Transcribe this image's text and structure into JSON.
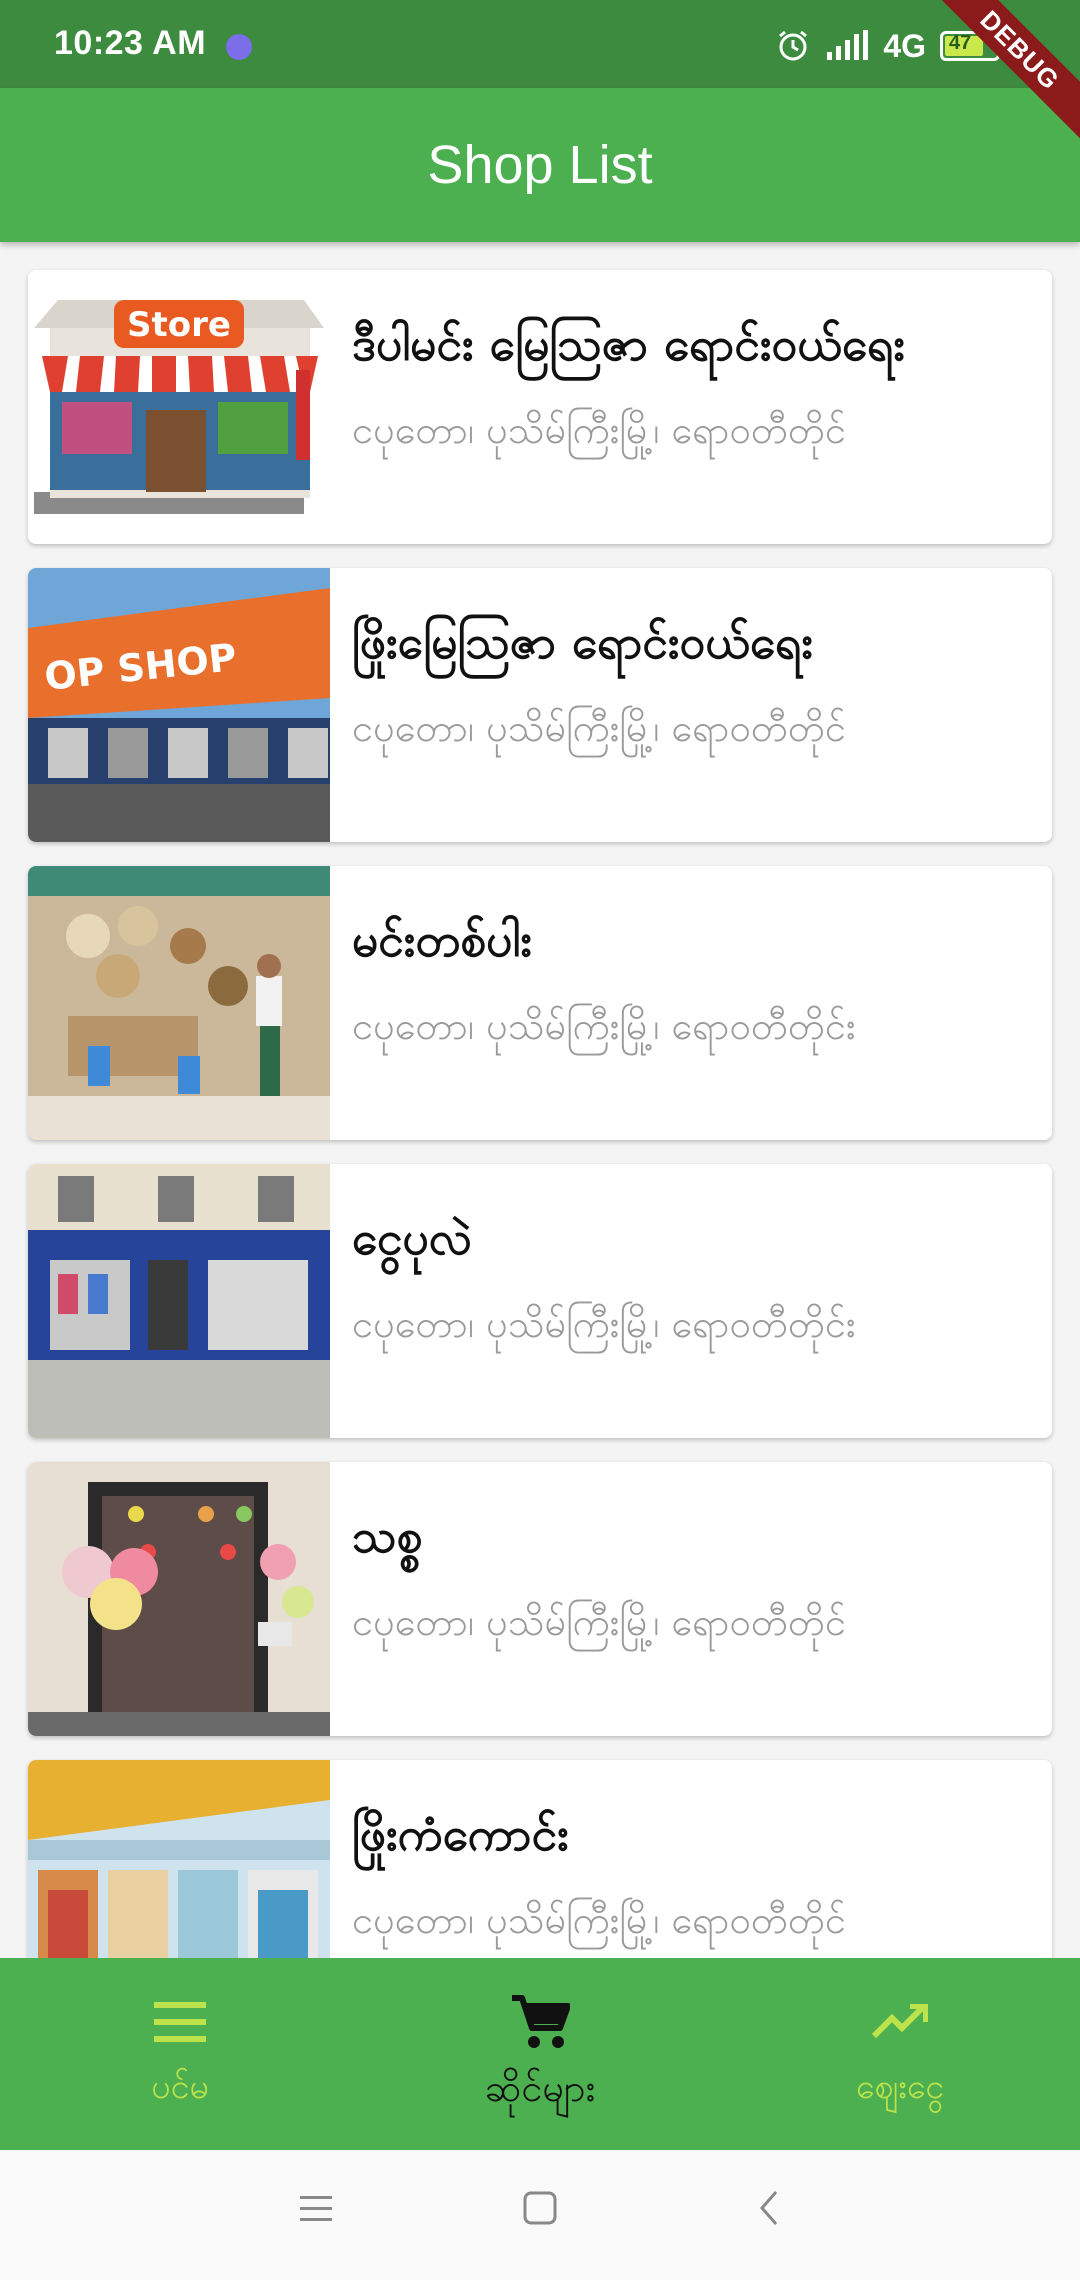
{
  "status_bar": {
    "time": "10:23 AM",
    "network": "4G",
    "battery": "47"
  },
  "debug_banner": "DEBUG",
  "app_bar": {
    "title": "Shop List"
  },
  "shops": [
    {
      "name": "ဒီပါမင်း မြေသြဇာ ရောင်းဝယ်ရေး",
      "address": "ငပုတော၊ ပုသိမ်ကြီးမြို့၊ ရောဝတီတိုင်"
    },
    {
      "name": "ဖြိုးမြေသြဇာ ရောင်းဝယ်ရေး",
      "address": "ငပုတော၊ ပုသိမ်ကြီးမြို့၊ ရောဝတီတိုင်"
    },
    {
      "name": "မင်းတစ်ပါး",
      "address": "ငပုတော၊ ပုသိမ်ကြီးမြို့၊ ရောဝတီတိုင်း"
    },
    {
      "name": "ငွေပုလဲ",
      "address": "ငပုတော၊ ပုသိမ်ကြီးမြို့၊ ရောဝတီတိုင်း"
    },
    {
      "name": "သစ္စ",
      "address": "ငပုတော၊ ပုသိမ်ကြီးမြို့၊ ရောဝတီတိုင်"
    },
    {
      "name": "ဖြိုးကံကောင်း",
      "address": "ငပုတော၊ ပုသိမ်ကြီးမြို့၊ ရောဝတီတိုင်"
    }
  ],
  "bottom_nav": {
    "items": [
      {
        "label": "ပင်မ",
        "icon": "menu-icon",
        "active": false
      },
      {
        "label": "ဆိုင်များ",
        "icon": "cart-icon",
        "active": true
      },
      {
        "label": "ဈေးငွေ",
        "icon": "trending-icon",
        "active": false
      }
    ]
  },
  "colors": {
    "primary": "#4caf50",
    "status_bar": "#3d8b3e",
    "inactive_nav": "#bde34c",
    "address_text": "#9a9a9a"
  }
}
